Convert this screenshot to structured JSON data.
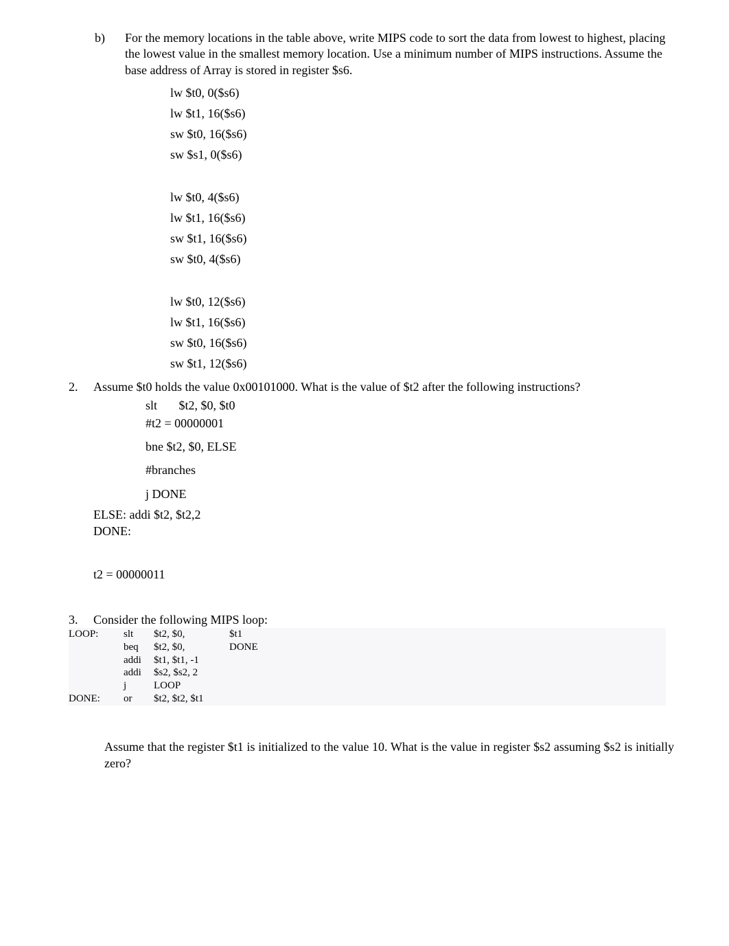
{
  "q1": {
    "marker": "b)",
    "text": "For the memory locations in the table above, write MIPS code to sort the data from lowest to highest, placing the lowest value in the smallest memory location. Use a minimum number of MIPS instructions. Assume the base address of Array is stored in register $s6.",
    "code_blocks": [
      [
        "lw $t0, 0($s6)",
        "lw $t1, 16($s6)",
        "sw $t0, 16($s6)",
        "sw $s1, 0($s6)"
      ],
      [
        "lw $t0, 4($s6)",
        "lw $t1, 16($s6)",
        "sw $t1, 16($s6)",
        "sw $t0, 4($s6)"
      ],
      [
        "lw $t0, 12($s6)",
        "lw $t1, 16($s6)",
        "sw $t0, 16($s6)",
        "sw $t1, 12($s6)"
      ]
    ]
  },
  "q2": {
    "marker": "2.",
    "text": "Assume $t0 holds the value 0x00101000. What is the value of $t2 after the following instructions?",
    "lines": [
      "slt       $t2, $0, $t0",
      "#t2 = 00000001",
      "bne $t2, $0, ELSE",
      "#branches",
      "j DONE"
    ],
    "else_block": [
      "ELSE: addi $t2, $t2,2",
      "DONE:"
    ],
    "answer": "t2 = 00000011"
  },
  "q3": {
    "marker": "3.",
    "text": "Consider the following MIPS loop:",
    "code": [
      {
        "lbl": "LOOP:",
        "op": "slt",
        "arg": "$t2, $0,",
        "tgt": "$t1"
      },
      {
        "lbl": "",
        "op": "beq",
        "arg": "$t2, $0,",
        "tgt": "DONE"
      },
      {
        "lbl": "",
        "op": "addi",
        "arg": "$t1, $t1, -1",
        "tgt": ""
      },
      {
        "lbl": "",
        "op": "addi",
        "arg": "$s2, $s2, 2",
        "tgt": ""
      },
      {
        "lbl": "",
        "op": "j",
        "arg": "LOOP",
        "tgt": ""
      },
      {
        "lbl": "DONE:",
        "op": "or",
        "arg": "$t2, $t2, $t1",
        "tgt": ""
      }
    ],
    "assume": "Assume that the register $t1 is initialized to the value 10. What is the value in register $s2 assuming $s2 is initially zero?"
  }
}
